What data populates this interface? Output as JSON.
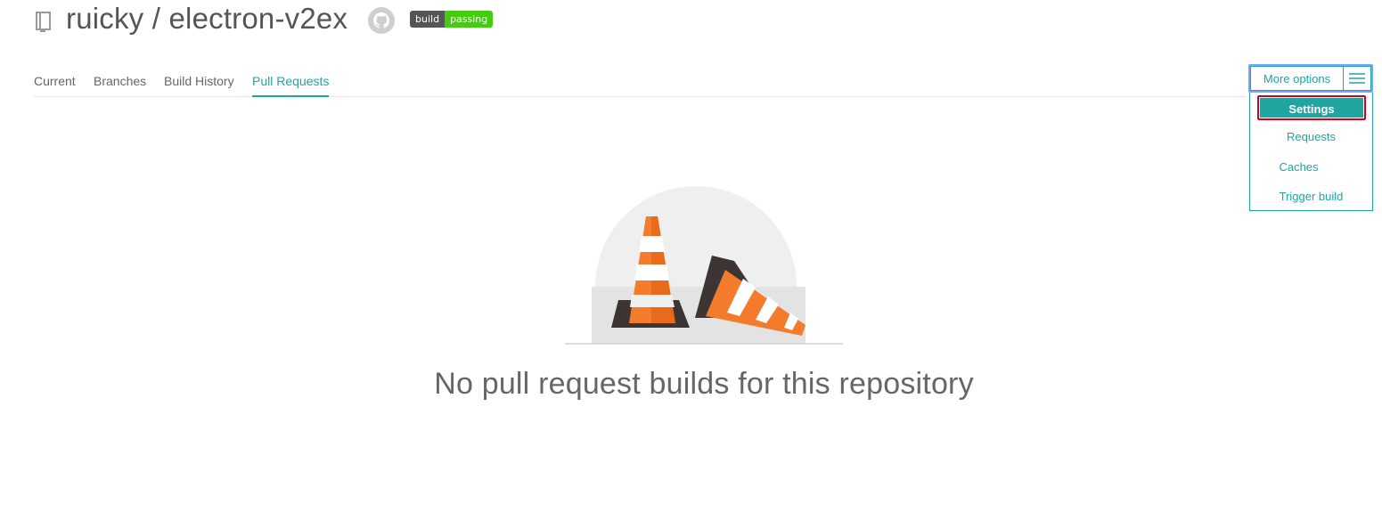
{
  "repo": {
    "title": "ruicky / electron-v2ex",
    "badge_left": "build",
    "badge_right": "passing",
    "badge_colors": {
      "left": "#555555",
      "right": "#44cc11"
    }
  },
  "tabs": [
    {
      "label": "Current",
      "active": false
    },
    {
      "label": "Branches",
      "active": false
    },
    {
      "label": "Build History",
      "active": false
    },
    {
      "label": "Pull Requests",
      "active": true
    }
  ],
  "more_options": {
    "label": "More options",
    "items": [
      {
        "label": "Settings",
        "selected": true
      },
      {
        "label": "Requests",
        "selected": false
      },
      {
        "label": "Caches",
        "selected": false
      },
      {
        "label": "Trigger build",
        "selected": false
      }
    ]
  },
  "empty_state": {
    "message": "No pull request builds for this repository"
  },
  "colors": {
    "accent": "#21a5a0",
    "cone_orange": "#f47b2b",
    "cone_base": "#3c3533",
    "highlight_border": "#d0021b"
  }
}
